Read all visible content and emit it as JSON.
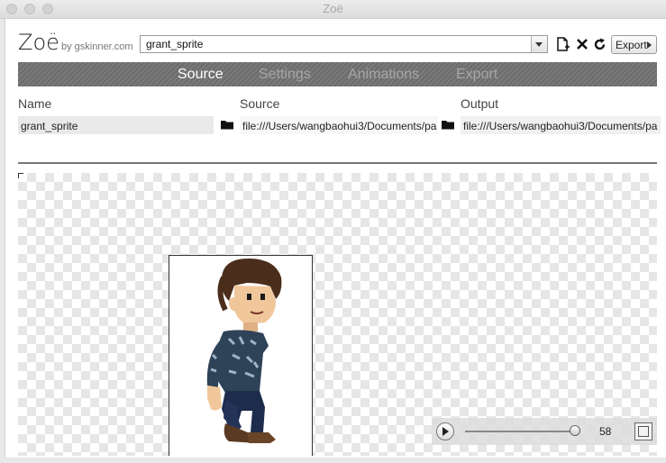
{
  "window": {
    "title": "Zoë"
  },
  "header": {
    "logo": "Zoë",
    "byline": "by gskinner.com",
    "project_select": {
      "value": "grant_sprite"
    },
    "export_label": "Export"
  },
  "tabs": [
    {
      "label": "Source",
      "active": true
    },
    {
      "label": "Settings",
      "active": false
    },
    {
      "label": "Animations",
      "active": false
    },
    {
      "label": "Export",
      "active": false
    }
  ],
  "fields": {
    "name": {
      "label": "Name",
      "value": "grant_sprite"
    },
    "source": {
      "label": "Source",
      "value": "file:///Users/wangbaohui3/Documents/pa"
    },
    "output": {
      "label": "Output",
      "value": "file:///Users/wangbaohui3/Documents/pa"
    }
  },
  "playback": {
    "frame": "58",
    "progress": 0.95
  },
  "icons": {
    "new": "new-document-icon",
    "delete": "close-x-icon",
    "refresh": "refresh-icon",
    "folder": "folder-icon",
    "play": "play-icon",
    "resize": "resize-icon"
  },
  "colors": {
    "tab_active": "#ffffff",
    "tab_inactive": "#a6a6a6",
    "tabbar": "#737373"
  }
}
